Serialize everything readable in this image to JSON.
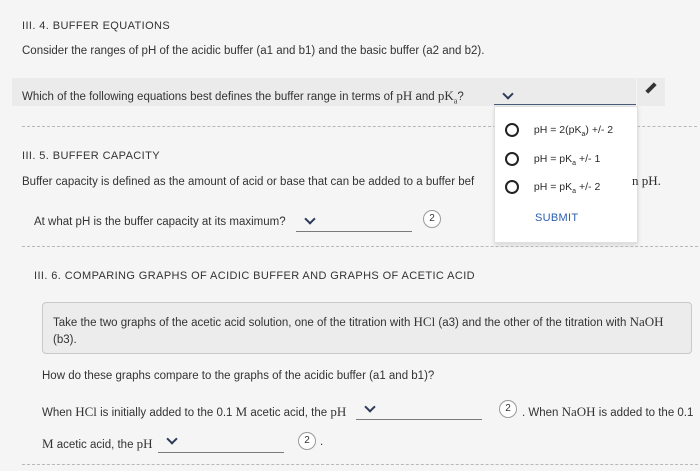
{
  "s1": {
    "title": "III. 4. BUFFER EQUATIONS",
    "intro": "Consider the ranges of pH of the acidic buffer (a1 and b1) and the basic buffer (a2 and b2).",
    "question_prefix": "Which of the following equations best defines the buffer range in terms of ",
    "question_pH": "pH",
    "question_and": " and ",
    "question_pK": "pK",
    "question_pK_sub": "a",
    "question_end": "?"
  },
  "dropdown": {
    "options": [
      {
        "pre": "pH = 2(pK",
        "sub": "a",
        "post": ") +/- 2"
      },
      {
        "pre": "pH = pK",
        "sub": "a",
        "post": " +/- 1"
      },
      {
        "pre": "pH = pK",
        "sub": "a",
        "post": " +/- 2"
      }
    ],
    "submit": "SUBMIT"
  },
  "s2": {
    "title": "III. 5. BUFFER CAPACITY",
    "text": "Buffer capacity is defined as the amount of acid or base that can be added to a buffer bef",
    "text_tail_visible": "n pH.",
    "question": "At what pH is the buffer capacity at its maximum?",
    "badge": "2"
  },
  "s3": {
    "title": "III. 6. COMPARING GRAPHS OF ACIDIC BUFFER AND GRAPHS OF ACETIC ACID",
    "box_pre": "Take the two graphs of the acetic acid solution, one of the titration with ",
    "box_hcl": "HCl",
    "box_mid": " (a3) and the other of the titration with ",
    "box_naoh": "NaOH",
    "box_end": "(b3).",
    "question": "How do these graphs compare to the graphs of the acidic buffer (a1 and b1)?",
    "line1_pre": "When ",
    "line1_hcl": "HCl",
    "line1_mid": " is initially added to the 0.1 ",
    "line1_M": "M",
    "line1_post": " acetic acid, the ",
    "line1_pH": "pH",
    "badge1": "2",
    "line1_after": ". When ",
    "line1_naoh": "NaOH",
    "line1_after2": " is added to the 0.1",
    "line2_M": "M",
    "line2_mid": " acetic acid, the ",
    "line2_pH": "pH",
    "badge2": "2",
    "line2_end": "."
  }
}
